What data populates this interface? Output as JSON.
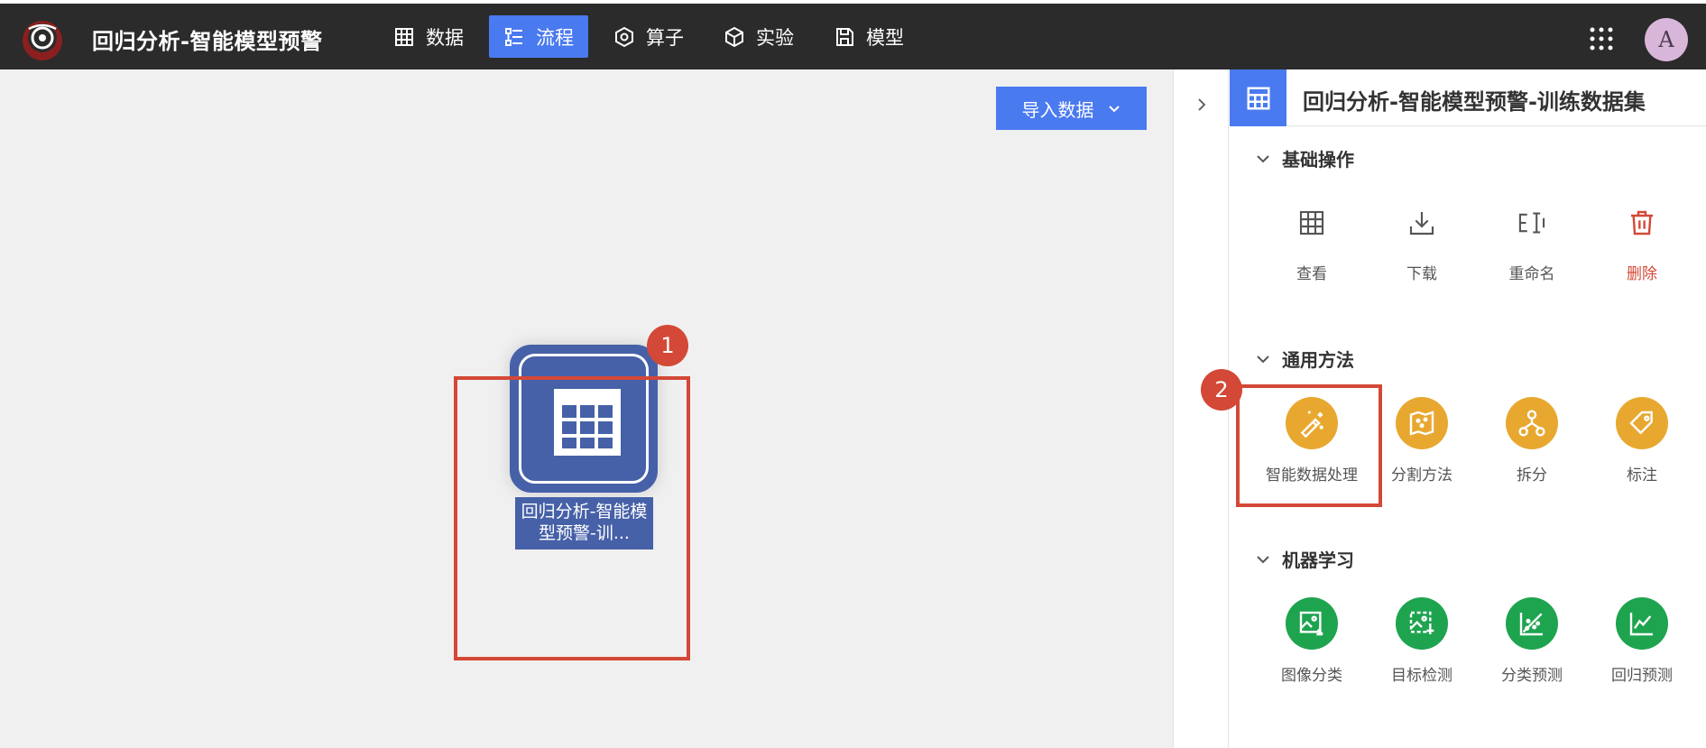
{
  "app": {
    "title": "回归分析-智能模型预警",
    "avatar_letter": "A"
  },
  "nav": {
    "items": [
      {
        "label": "数据",
        "icon": "table-icon",
        "active": false
      },
      {
        "label": "流程",
        "icon": "flow-icon",
        "active": true
      },
      {
        "label": "算子",
        "icon": "hexagon-icon",
        "active": false
      },
      {
        "label": "实验",
        "icon": "cube-icon",
        "active": false
      },
      {
        "label": "模型",
        "icon": "save-icon",
        "active": false
      }
    ]
  },
  "canvas": {
    "import_button": "导入数据",
    "node": {
      "label": "回归分析-智能模型预警-训...",
      "icon": "table-icon"
    },
    "annotations": [
      "1",
      "2"
    ]
  },
  "panel": {
    "title": "回归分析-智能模型预警-训练数据集",
    "sections": [
      {
        "title": "基础操作",
        "items": [
          {
            "label": "查看",
            "icon": "table-icon"
          },
          {
            "label": "下载",
            "icon": "download-icon"
          },
          {
            "label": "重命名",
            "icon": "rename-icon"
          },
          {
            "label": "删除",
            "icon": "trash-icon"
          }
        ]
      },
      {
        "title": "通用方法",
        "items": [
          {
            "label": "智能数据处理",
            "icon": "magic-wand-icon"
          },
          {
            "label": "分割方法",
            "icon": "split-map-icon"
          },
          {
            "label": "拆分",
            "icon": "branch-icon"
          },
          {
            "label": "标注",
            "icon": "tag-icon"
          }
        ]
      },
      {
        "title": "机器学习",
        "items": [
          {
            "label": "图像分类",
            "icon": "image-classify-icon"
          },
          {
            "label": "目标检测",
            "icon": "object-detect-icon"
          },
          {
            "label": "分类预测",
            "icon": "scatter-icon"
          },
          {
            "label": "回归预测",
            "icon": "line-chart-icon"
          }
        ]
      }
    ]
  },
  "colors": {
    "topbar": "#2b2b2b",
    "accent": "#4a7af0",
    "node": "#4661a8",
    "annotation": "#d34836",
    "orange": "#e8a830",
    "green": "#1ea44f",
    "danger": "#d34836"
  }
}
